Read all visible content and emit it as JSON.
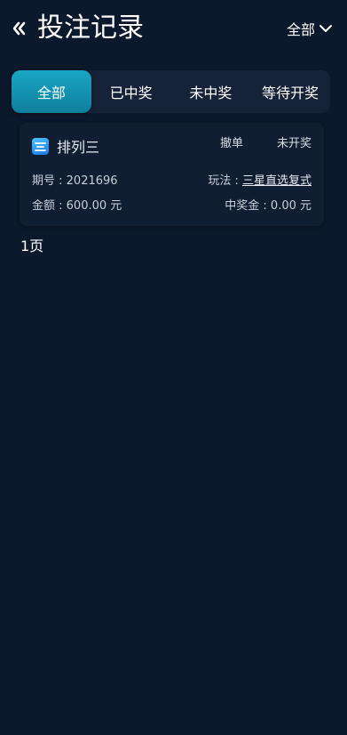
{
  "header": {
    "title": "投注记录",
    "filter_label": "全部"
  },
  "tabs": [
    {
      "label": "全部",
      "active": true
    },
    {
      "label": "已中奖",
      "active": false
    },
    {
      "label": "未中奖",
      "active": false
    },
    {
      "label": "等待开奖",
      "active": false
    }
  ],
  "record": {
    "lottery_name": "排列三",
    "cancel_label": "撤单",
    "status": "未开奖",
    "issue_label": "期号 : ",
    "issue_value": "2021696",
    "play_label": "玩法 : ",
    "play_value": "三星直选复式",
    "amount_label": "金额 : ",
    "amount_value": "600.00 元",
    "prize_label": "中奖金 : ",
    "prize_value": "0.00 元"
  },
  "pagination": {
    "label": "1页"
  },
  "icons": {
    "back": "chevron-left-double-icon",
    "dropdown": "chevron-down-icon",
    "lottery": "lottery-app-icon"
  },
  "colors": {
    "background": "#0c182b",
    "tab_bar": "#162237",
    "tab_active": "#1aa6c4",
    "card": "#111d31"
  }
}
